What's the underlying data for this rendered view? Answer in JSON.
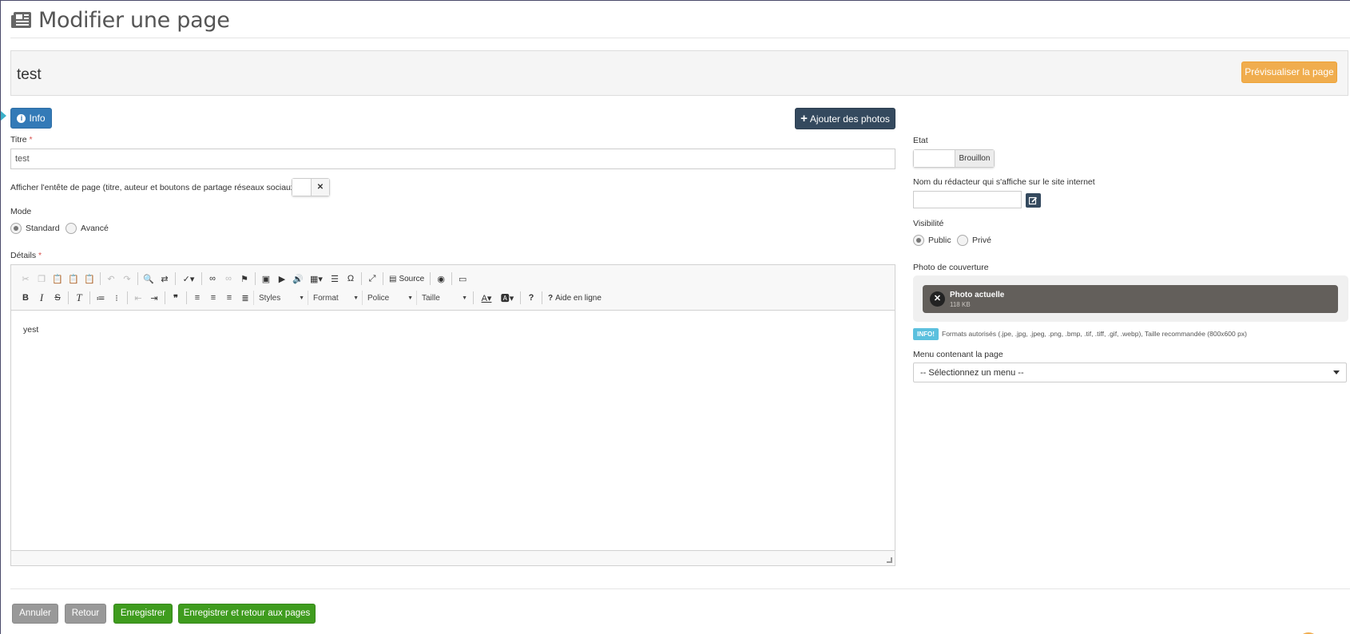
{
  "header": {
    "title": "Modifier une page",
    "icon": "newspaper-icon"
  },
  "page_name": "test",
  "preview_button": "Prévisualiser la page",
  "info_button": "Info",
  "add_photos_button": "Ajouter des photos",
  "form": {
    "title_label": "Titre",
    "required_mark": "*",
    "title_value": "test",
    "show_header_label": "Afficher l'entête de page (titre, auteur et boutons de partage réseaux sociaux) ?",
    "show_header_toggle_off": "✕",
    "mode_label": "Mode",
    "mode_options": [
      "Standard",
      "Avancé"
    ],
    "mode_selected": "Standard",
    "details_label": "Détails"
  },
  "editor": {
    "source_label": "Source",
    "styles_combo": "Styles",
    "format_combo": "Format",
    "font_combo": "Police",
    "size_combo": "Taille",
    "help_label": "Aide en ligne",
    "content": "yest"
  },
  "sidebar": {
    "state_label": "Etat",
    "state_value": "Brouillon",
    "author_label": "Nom du rédacteur qui s'affiche sur le site internet",
    "author_value": "",
    "visibility_label": "Visibilité",
    "visibility_options": [
      "Public",
      "Privé"
    ],
    "visibility_selected": "Public",
    "cover_label": "Photo de couverture",
    "cover_photo_name": "Photo actuelle",
    "cover_photo_size": "118 KB",
    "info_badge": "INFO!",
    "formats_text": "Formats autorisés (.jpe, .jpg, .jpeg, .png, .bmp, .tif, .tiff, .gif, .webp), Taille recommandée (800x600 px)",
    "menu_label": "Menu contenant la page",
    "menu_select": "-- Sélectionnez un menu --"
  },
  "footer": {
    "cancel": "Annuler",
    "back": "Retour",
    "save": "Enregistrer",
    "save_and_back": "Enregistrer et retour aux pages"
  },
  "colors": {
    "primary": "#337ab7",
    "dark": "#34495e",
    "warning": "#f0ad4e",
    "success": "#3f9c1e",
    "info": "#5bc0de"
  }
}
